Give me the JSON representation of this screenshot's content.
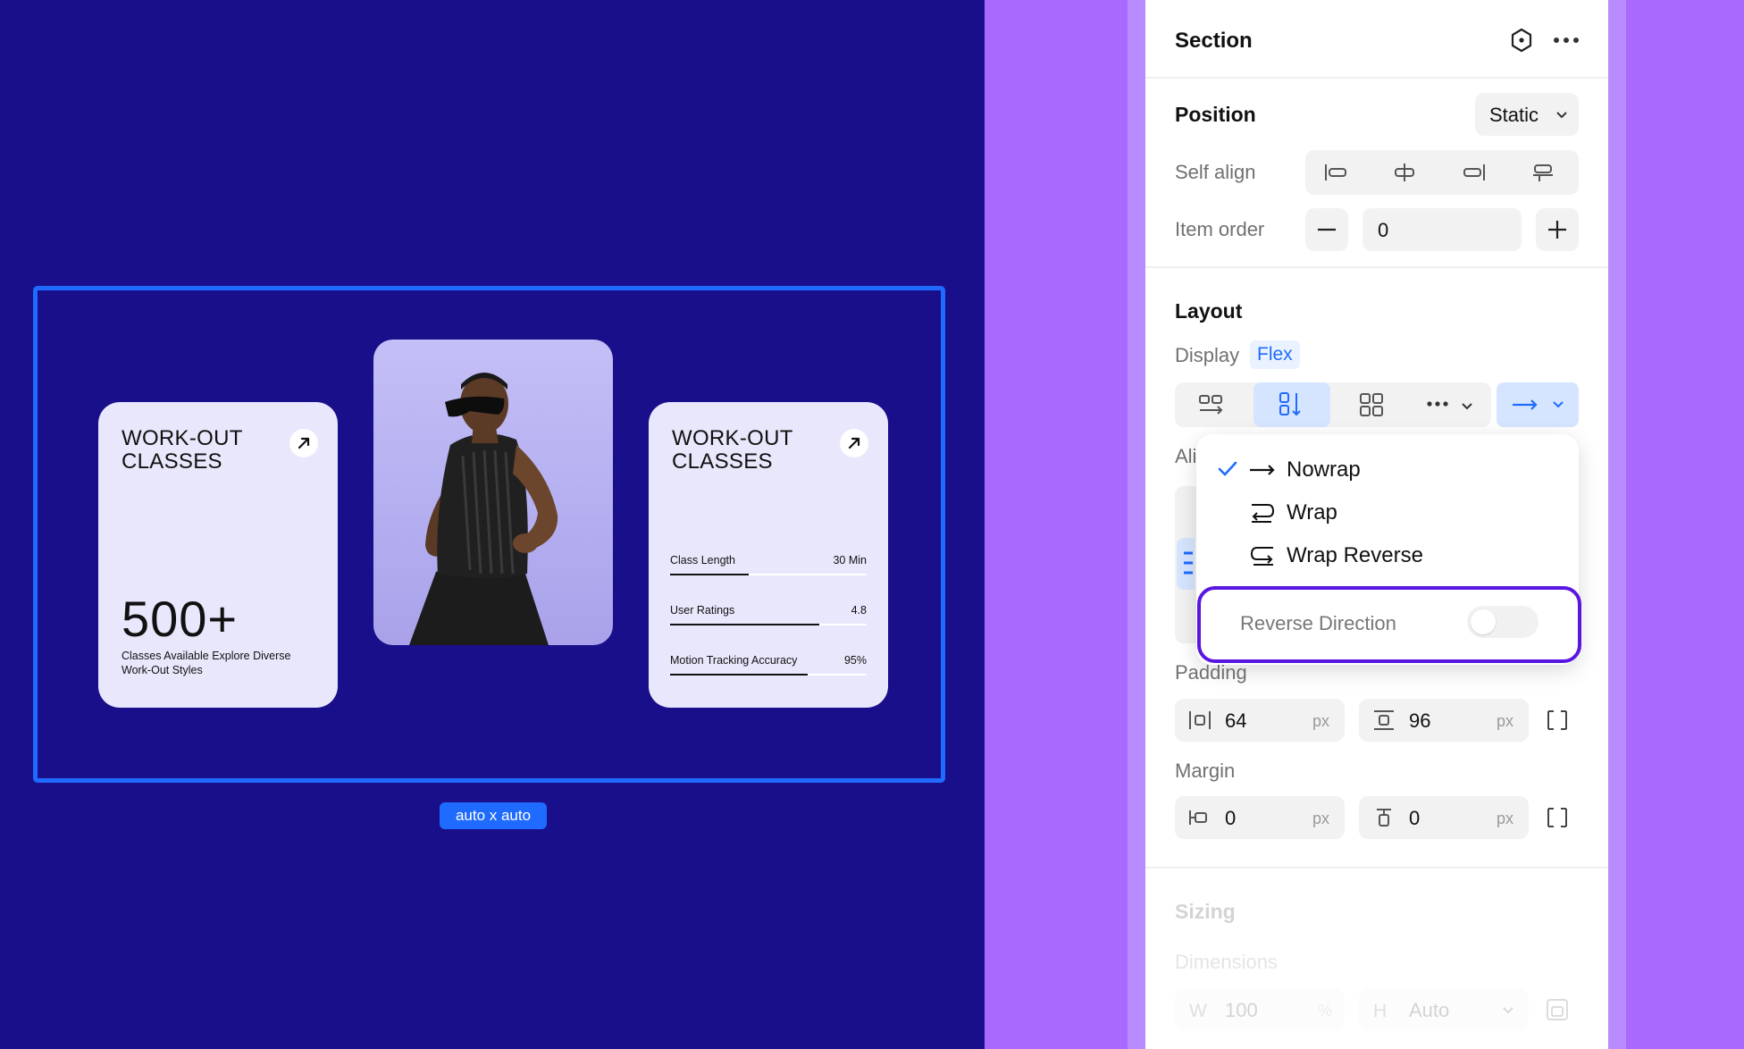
{
  "canvas": {
    "size_badge": "auto x auto",
    "cards": [
      {
        "title": "WORK-OUT CLASSES",
        "big_number": "500+",
        "description": "Classes Available Explore Diverse Work-Out Styles"
      },
      {
        "title": "WORK-OUT CLASSES",
        "stats": [
          {
            "label": "Class Length",
            "value": "30 Min",
            "progress": 0.4
          },
          {
            "label": "User Ratings",
            "value": "4.8",
            "progress": 0.76
          },
          {
            "label": "Motion Tracking Accuracy",
            "value": "95%",
            "progress": 0.7
          }
        ]
      }
    ]
  },
  "panel": {
    "header": {
      "title": "Section"
    },
    "position": {
      "title": "Position",
      "value": "Static"
    },
    "self_align": {
      "label": "Self align"
    },
    "item_order": {
      "label": "Item order",
      "value": "0"
    },
    "layout": {
      "title": "Layout",
      "display_label": "Display",
      "display_value": "Flex",
      "align_label_partial": "Ali"
    },
    "wrap_dropdown": {
      "options": [
        "Nowrap",
        "Wrap",
        "Wrap Reverse"
      ],
      "selected": "Nowrap",
      "reverse_label": "Reverse Direction",
      "reverse_on": false
    },
    "padding": {
      "label": "Padding",
      "horizontal": "64",
      "vertical": "96",
      "unit": "px"
    },
    "margin": {
      "label": "Margin",
      "horizontal": "0",
      "vertical": "0",
      "unit": "px"
    },
    "sizing": {
      "title": "Sizing",
      "dimensions_label": "Dimensions",
      "w_label": "W",
      "w_value": "100",
      "w_unit": "%",
      "h_label": "H",
      "h_value": "Auto"
    }
  },
  "colors": {
    "canvas_bg": "#1a0f8a",
    "accent": "#1f6bff",
    "highlight": "#5a16e0",
    "purple_bg": "#a969ff"
  }
}
